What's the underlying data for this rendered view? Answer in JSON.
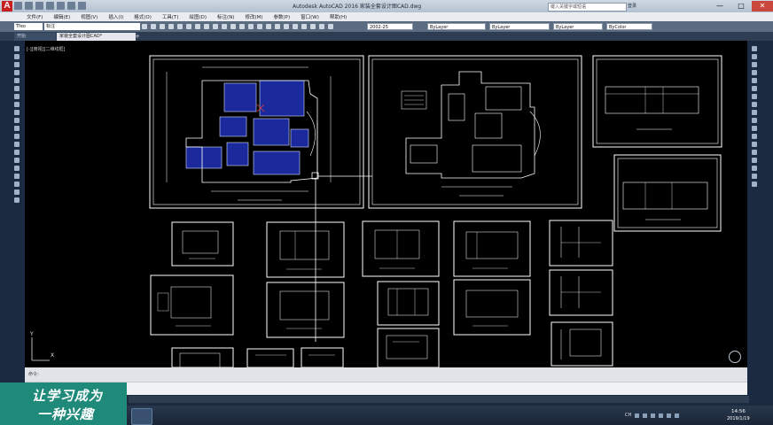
{
  "titlebar": {
    "app_logo": "A",
    "title": "Autodesk AutoCAD 2016   家装全套设计图CAD.dwg",
    "search_placeholder": "键入关键字或短语",
    "user": "登录",
    "minimize": "—",
    "maximize": "□",
    "close": "✕"
  },
  "menu": [
    "文件(F)",
    "编辑(E)",
    "视图(V)",
    "插入(I)",
    "格式(O)",
    "工具(T)",
    "绘图(D)",
    "标注(N)",
    "修改(M)",
    "参数(P)",
    "窗口(W)",
    "帮助(H)"
  ],
  "toolbar": {
    "workspace": "Tfeo",
    "layer": "标注",
    "textstyle": "2002-25",
    "color": "ByLayer",
    "linetype": "ByLayer",
    "lineweight": "ByLayer",
    "plotstyle": "ByColor"
  },
  "tabs": {
    "start": "开始",
    "active": "家装全套设计图CAD*",
    "plus": "+"
  },
  "viewport_label": "[-][俯视][二维线框]",
  "ucs": {
    "x": "X",
    "y": "Y"
  },
  "command": {
    "prompt": "命令:"
  },
  "watermark": {
    "line1": "让学习成为",
    "line2": "一种兴趣"
  },
  "tray": {
    "lang": "CH"
  },
  "clock": {
    "time": "14:56",
    "date": "2019/1/19"
  },
  "colors": {
    "canvas": "#000000",
    "linework": "#ffffff",
    "fill_blue": "#1a2a9c",
    "accent_red": "#c8201f",
    "watermark_bg": "#1f8a7a"
  }
}
